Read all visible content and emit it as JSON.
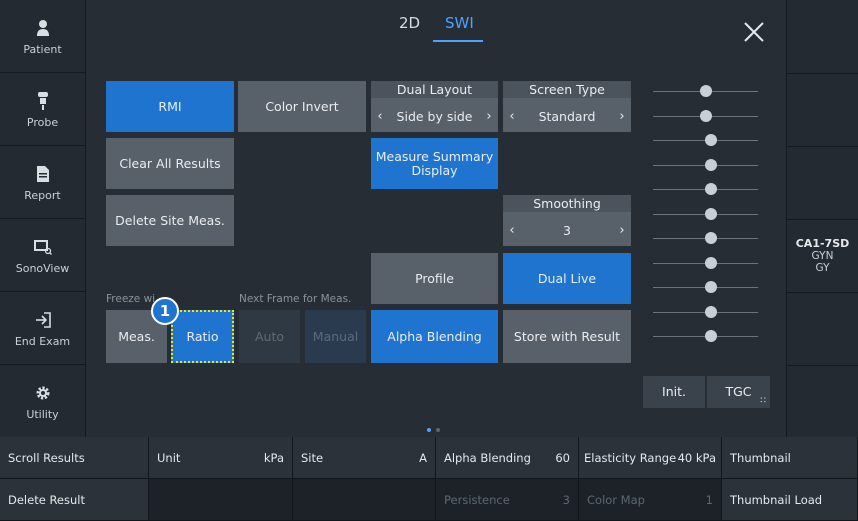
{
  "sidebar": {
    "items": [
      {
        "label": "Patient",
        "icon": "person-icon"
      },
      {
        "label": "Probe",
        "icon": "probe-icon"
      },
      {
        "label": "Report",
        "icon": "document-icon"
      },
      {
        "label": "SonoView",
        "icon": "sonoview-icon"
      },
      {
        "label": "End Exam",
        "icon": "exit-icon"
      },
      {
        "label": "Utility",
        "icon": "gear-icon"
      }
    ]
  },
  "tabs": [
    {
      "label": "2D"
    },
    {
      "label": "SWI"
    }
  ],
  "buttons": {
    "rmi": "RMI",
    "color_invert": "Color Invert",
    "clear_all": "Clear All Results",
    "delete_site": "Delete Site Meas.",
    "measure_summary_line1": "Measure Summary",
    "measure_summary_line2": "Display",
    "profile": "Profile",
    "dual_live": "Dual Live",
    "alpha_blending": "Alpha Blending",
    "store_with_result": "Store with Result",
    "meas": "Meas.",
    "ratio": "Ratio",
    "auto": "Auto",
    "manual": "Manual",
    "init": "Init.",
    "tgc": "TGC"
  },
  "steppers": {
    "dual_layout": {
      "title": "Dual Layout",
      "value": "Side by side"
    },
    "screen_type": {
      "title": "Screen Type",
      "value": "Standard"
    },
    "smoothing": {
      "title": "Smoothing",
      "value": "3"
    }
  },
  "labels": {
    "freeze": "Freeze wi",
    "next_frame": "Next Frame for Meas.",
    "badge": "1"
  },
  "probe_info": {
    "probe": "CA1-7SD",
    "preset1": "GYN",
    "preset2": "GY"
  },
  "tgc_sliders": [
    0.5,
    0.5,
    0.55,
    0.55,
    0.55,
    0.55,
    0.55,
    0.55,
    0.55,
    0.55,
    0.55
  ],
  "bottom": {
    "row1": {
      "scroll_results": "Scroll Results",
      "unit_label": "Unit",
      "unit_value": "kPa",
      "site_label": "Site",
      "site_value": "A",
      "alpha_label": "Alpha Blending",
      "alpha_value": "60",
      "elasticity_label": "Elasticity Range",
      "elasticity_value": "40 kPa",
      "thumbnail": "Thumbnail"
    },
    "row2": {
      "delete_result": "Delete Result",
      "persistence_label": "Persistence",
      "persistence_value": "3",
      "colormap_label": "Color Map",
      "colormap_value": "1",
      "thumbnail_load": "Thumbnail Load"
    }
  },
  "colors": {
    "accent": "#1f74cf",
    "tab_active": "#4ba3ff",
    "badge": "#1f74cf",
    "focus": "#f3e600"
  }
}
